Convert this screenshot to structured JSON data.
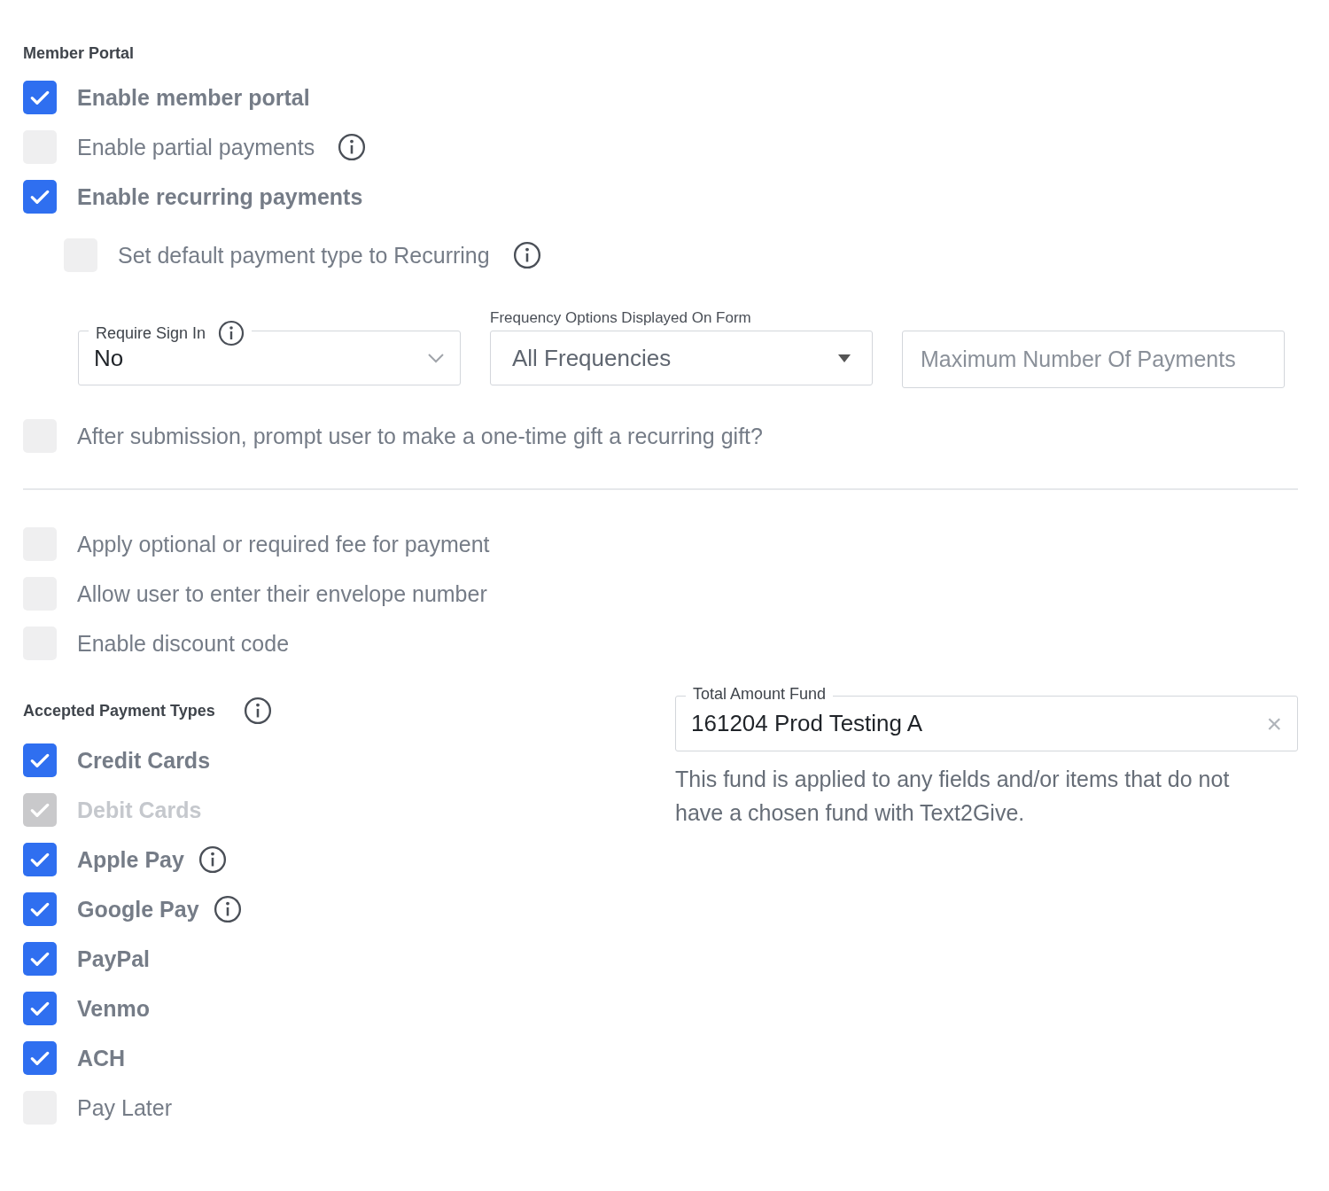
{
  "member_portal": {
    "heading": "Member Portal",
    "options": [
      {
        "label": "Enable member portal",
        "checked": true
      },
      {
        "label": "Enable partial payments",
        "checked": false,
        "info": true
      },
      {
        "label": "Enable recurring payments",
        "checked": true,
        "children": [
          {
            "label": "Set default payment type to Recurring",
            "checked": false,
            "info": true
          }
        ]
      }
    ]
  },
  "recurring_settings": {
    "require_sign_in": {
      "label": "Require Sign In",
      "info": true,
      "value": "No"
    },
    "frequency": {
      "label": "Frequency Options Displayed On Form",
      "value": "All Frequencies"
    },
    "max_payments": {
      "placeholder": "Maximum Number Of Payments"
    }
  },
  "prompt_option": {
    "label": "After submission, prompt user to make a one-time gift a recurring gift?",
    "checked": false
  },
  "fee_options": [
    {
      "label": "Apply optional or required fee for payment",
      "checked": false
    },
    {
      "label": "Allow user to enter their envelope number",
      "checked": false
    },
    {
      "label": "Enable discount code",
      "checked": false
    }
  ],
  "payment_types": {
    "heading": "Accepted Payment Types",
    "info": true,
    "options": [
      {
        "label": "Credit Cards",
        "checked": true,
        "disabled": false
      },
      {
        "label": "Debit Cards",
        "checked": true,
        "disabled": true
      },
      {
        "label": "Apple Pay",
        "checked": true,
        "disabled": false,
        "info": true
      },
      {
        "label": "Google Pay",
        "checked": true,
        "disabled": false,
        "info": true
      },
      {
        "label": "PayPal",
        "checked": true,
        "disabled": false
      },
      {
        "label": "Venmo",
        "checked": true,
        "disabled": false
      },
      {
        "label": "ACH",
        "checked": true,
        "disabled": false
      },
      {
        "label": "Pay Later",
        "checked": false,
        "disabled": false
      }
    ]
  },
  "fund": {
    "label": "Total Amount Fund",
    "value": "161204 Prod Testing A",
    "clear": "×",
    "help": "This fund is applied to any fields and/or items that do not have a chosen fund with Text2Give."
  }
}
